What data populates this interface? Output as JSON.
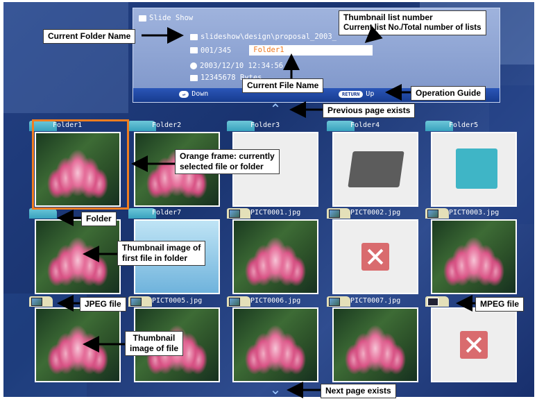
{
  "info_panel": {
    "title": "Slide Show",
    "path": "slideshow\\design\\proposal_2003_",
    "list_number": "001/345",
    "file_name": "Folder1",
    "datetime": "2003/12/10 12:34:56",
    "size": "12345678 Bytes",
    "guide_down_label": "Down",
    "guide_return_pill": "RETURN",
    "guide_up_label": "Up"
  },
  "tiles": [
    {
      "label": "Folder1",
      "kind": "folder",
      "content": "lotus"
    },
    {
      "label": "Folder2",
      "kind": "folder",
      "content": "lotus"
    },
    {
      "label": "Folder3",
      "kind": "folder",
      "content": "blank"
    },
    {
      "label": "Folder4",
      "kind": "folder",
      "content": "folder-grey"
    },
    {
      "label": "Folder5",
      "kind": "folder",
      "content": "folder-teal"
    },
    {
      "label": "",
      "kind": "folder",
      "content": "lotus"
    },
    {
      "label": "Folder7",
      "kind": "folder",
      "content": "blank"
    },
    {
      "label": "PICT0001.jpg",
      "kind": "jpeg",
      "content": "lotus"
    },
    {
      "label": "PICT0002.jpg",
      "kind": "jpeg",
      "content": "broken"
    },
    {
      "label": "PICT0003.jpg",
      "kind": "jpeg",
      "content": "lotus"
    },
    {
      "label": "",
      "kind": "jpeg",
      "content": "lotus"
    },
    {
      "label": "PICT0005.jpg",
      "kind": "jpeg",
      "content": "lotus"
    },
    {
      "label": "PICT0006.jpg",
      "kind": "jpeg",
      "content": "lotus"
    },
    {
      "label": "PICT0007.jpg",
      "kind": "jpeg",
      "content": "lotus"
    },
    {
      "label": "",
      "kind": "mpeg",
      "content": "broken"
    }
  ],
  "callouts": {
    "current_folder_name": "Current Folder Name",
    "thumbnail_list_number": "Thumbnail list number",
    "thumbnail_list_number_sub": "Current list No./Total number of lists",
    "current_file_name": "Current File Name",
    "operation_guide": "Operation Guide",
    "previous_page": "Previous page exists",
    "orange_frame_line1": "Orange frame: currently",
    "orange_frame_line2": "selected file or folder",
    "folder": "Folder",
    "thumb_first_line1": "Thumbnail image of",
    "thumb_first_line2": "first file in folder",
    "jpeg_file": "JPEG file",
    "mpeg_file": "MPEG file",
    "thumb_file_line1": "Thumbnail",
    "thumb_file_line2": "image of file",
    "next_page": "Next page exists"
  },
  "colors": {
    "selection_frame": "#f07d20",
    "background": "#1d3a7a",
    "panel": "#8aa0d2"
  }
}
